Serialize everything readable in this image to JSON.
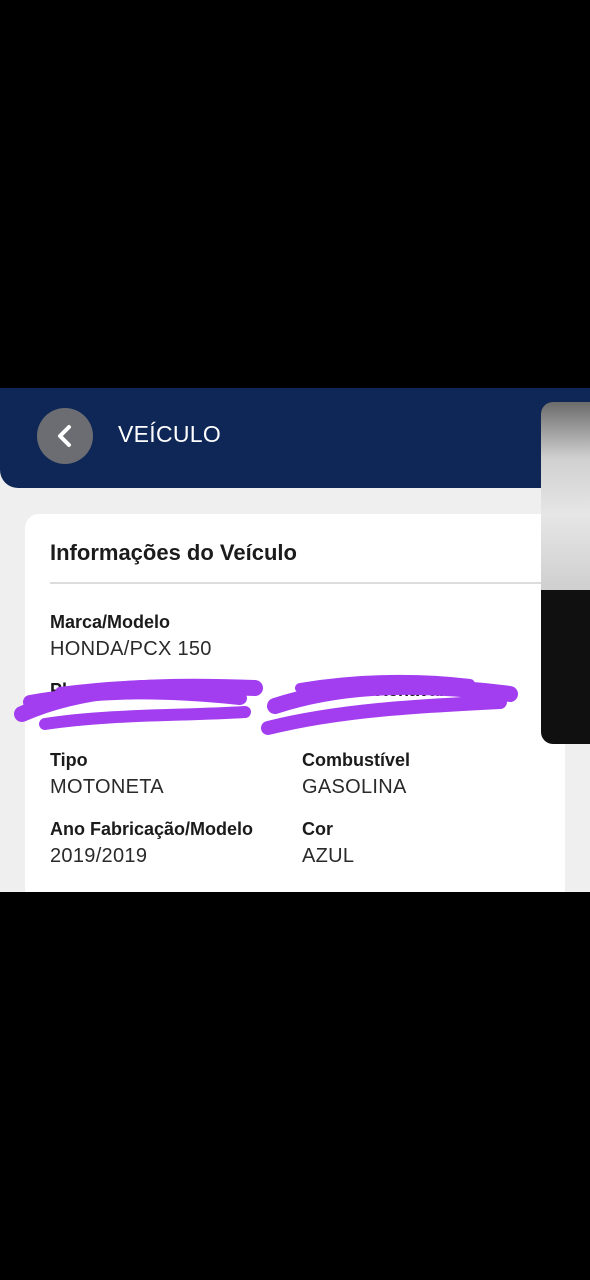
{
  "header": {
    "title": "VEÍCULO",
    "back_icon": "chevron-left-icon"
  },
  "card": {
    "title": "Informações do Veículo",
    "fields": {
      "marca_modelo": {
        "label": "Marca/Modelo",
        "value": "HONDA/PCX 150"
      },
      "placa": {
        "label": "Placa",
        "value": ""
      },
      "numero_renavam": {
        "label": "Número Renavam",
        "value": ""
      },
      "tipo": {
        "label": "Tipo",
        "value": "MOTONETA"
      },
      "combustivel": {
        "label": "Combustível",
        "value": "GASOLINA"
      },
      "ano": {
        "label": "Ano Fabricação/Modelo",
        "value": "2019/2019"
      },
      "cor": {
        "label": "Cor",
        "value": "AZUL"
      }
    }
  },
  "colors": {
    "header_bg": "#0f2756",
    "redaction": "#a23df0"
  }
}
